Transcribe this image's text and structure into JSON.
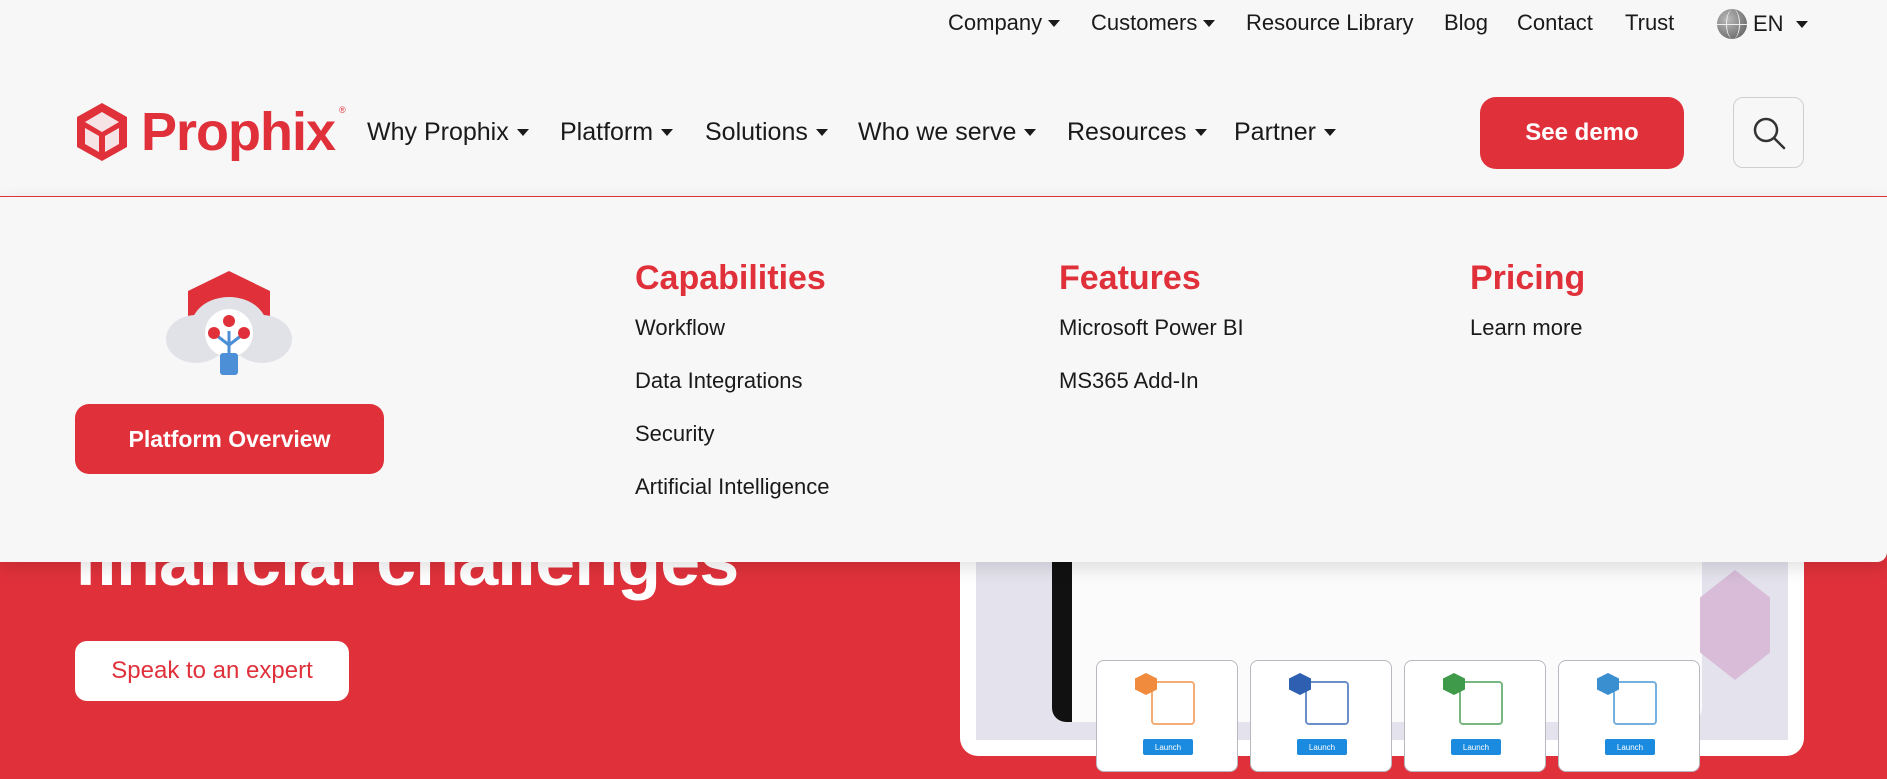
{
  "utility_nav": {
    "items": [
      {
        "label": "Company",
        "dropdown": true
      },
      {
        "label": "Customers",
        "dropdown": true
      },
      {
        "label": "Resource Library",
        "dropdown": false
      },
      {
        "label": "Blog",
        "dropdown": false
      },
      {
        "label": "Contact",
        "dropdown": false
      },
      {
        "label": "Trust",
        "dropdown": false
      }
    ],
    "language": {
      "label": "EN",
      "icon": "globe-icon"
    }
  },
  "brand": {
    "name": "Prophix",
    "registered": "®",
    "color": "#e0313b"
  },
  "main_nav": {
    "items": [
      {
        "label": "Why Prophix"
      },
      {
        "label": "Platform"
      },
      {
        "label": "Solutions"
      },
      {
        "label": "Who we serve"
      },
      {
        "label": "Resources"
      },
      {
        "label": "Partner"
      }
    ],
    "cta": "See demo",
    "search_icon": "search-icon"
  },
  "mega_menu": {
    "feature_icon": "cloud-lightbulb-icon",
    "overview_button": "Platform Overview",
    "columns": [
      {
        "title": "Capabilities",
        "links": [
          "Workflow",
          "Data Integrations",
          "Security",
          "Artificial Intelligence"
        ]
      },
      {
        "title": "Features",
        "links": [
          "Microsoft Power BI",
          "MS365 Add-In"
        ]
      },
      {
        "title": "Pricing",
        "links": [
          "Learn more"
        ]
      }
    ]
  },
  "hero": {
    "heading_fragment": "financial challenges",
    "cta": "Speak to an expert",
    "tiles": [
      {
        "launch": "Launch",
        "color": "#f08a3c"
      },
      {
        "launch": "Launch",
        "color": "#2f5fb0"
      },
      {
        "launch": "Launch",
        "color": "#3f9a4a"
      },
      {
        "launch": "Launch",
        "color": "#3a8fd0"
      }
    ]
  },
  "colors": {
    "accent": "#e0313b",
    "background": "#f7f7f8",
    "text": "#1a1a1a"
  }
}
